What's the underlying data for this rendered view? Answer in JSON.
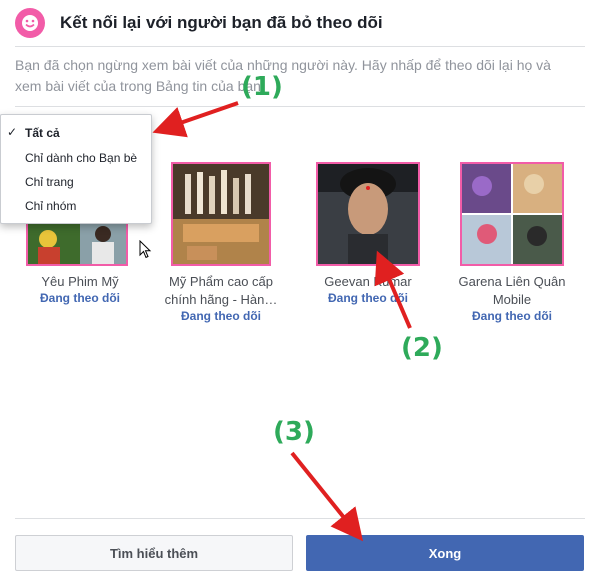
{
  "header": {
    "title": "Kết nối lại với người bạn đã bỏ theo dõi",
    "description": "Bạn đã chọn ngừng xem bài viết của những người này. Hãy nhấp để theo dõi lại họ và xem bài viết của trong Bảng tin của bạn."
  },
  "filter_menu": {
    "items": [
      {
        "label": "Tất cả",
        "selected": true
      },
      {
        "label": "Chỉ dành cho Bạn bè",
        "selected": false
      },
      {
        "label": "Chỉ trang",
        "selected": false
      },
      {
        "label": "Chỉ nhóm",
        "selected": false
      }
    ]
  },
  "profiles": [
    {
      "name": "Yêu Phim Mỹ",
      "status": "Đang theo dõi"
    },
    {
      "name": "Mỹ Phẩm cao cấp chính hãng - Hàn…",
      "status": "Đang theo dõi"
    },
    {
      "name": "Geevan Kumar",
      "status": "Đang theo dõi"
    },
    {
      "name": "Garena Liên Quân Mobile",
      "status": "Đang theo dõi"
    }
  ],
  "annotations": {
    "step1": "(1)",
    "step2": "(2)",
    "step3": "(3)"
  },
  "footer": {
    "learn_more": "Tìm hiểu thêm",
    "done": "Xong"
  },
  "colors": {
    "accent": "#4267b2",
    "highlight": "#f25ca8",
    "annotation": "#2eaa5a",
    "arrow": "#e02020"
  }
}
